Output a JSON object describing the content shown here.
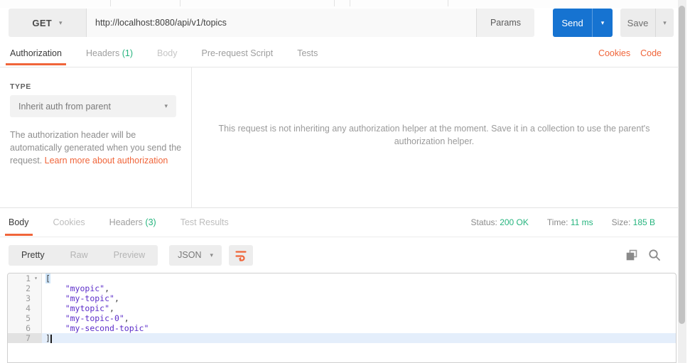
{
  "request": {
    "method": "GET",
    "url": "http://localhost:8080/api/v1/topics",
    "params_label": "Params",
    "send_label": "Send",
    "save_label": "Save"
  },
  "request_tabs": {
    "items": [
      {
        "label": "Authorization"
      },
      {
        "label": "Headers",
        "count": "(1)"
      },
      {
        "label": "Body"
      },
      {
        "label": "Pre-request Script"
      },
      {
        "label": "Tests"
      }
    ],
    "cookies_link": "Cookies",
    "code_link": "Code"
  },
  "auth": {
    "type_label": "TYPE",
    "type_value": "Inherit auth from parent",
    "description": "The authorization header will be automatically generated when you send the request. ",
    "learn_more": "Learn more about authorization",
    "helper_message": "This request is not inheriting any authorization helper at the moment. Save it in a collection to use the parent's authorization helper."
  },
  "response": {
    "tabs": [
      {
        "label": "Body"
      },
      {
        "label": "Cookies"
      },
      {
        "label": "Headers",
        "count": "(3)"
      },
      {
        "label": "Test Results"
      }
    ],
    "status_label": "Status:",
    "status_value": "200 OK",
    "time_label": "Time:",
    "time_value": "11 ms",
    "size_label": "Size:",
    "size_value": "185 B",
    "view_modes": {
      "pretty": "Pretty",
      "raw": "Raw",
      "preview": "Preview"
    },
    "format_value": "JSON",
    "body_lines": [
      {
        "num": "1",
        "fold": true,
        "tokens": [
          {
            "t": "pm",
            "v": "["
          }
        ]
      },
      {
        "num": "2",
        "tokens": [
          {
            "t": "p",
            "v": "    "
          },
          {
            "t": "s",
            "v": "\"myopic\""
          },
          {
            "t": "p",
            "v": ","
          }
        ]
      },
      {
        "num": "3",
        "tokens": [
          {
            "t": "p",
            "v": "    "
          },
          {
            "t": "s",
            "v": "\"my-topic\""
          },
          {
            "t": "p",
            "v": ","
          }
        ]
      },
      {
        "num": "4",
        "tokens": [
          {
            "t": "p",
            "v": "    "
          },
          {
            "t": "s",
            "v": "\"mytopic\""
          },
          {
            "t": "p",
            "v": ","
          }
        ]
      },
      {
        "num": "5",
        "tokens": [
          {
            "t": "p",
            "v": "    "
          },
          {
            "t": "s",
            "v": "\"my-topic-0\""
          },
          {
            "t": "p",
            "v": ","
          }
        ]
      },
      {
        "num": "6",
        "tokens": [
          {
            "t": "p",
            "v": "    "
          },
          {
            "t": "s",
            "v": "\"my-second-topic\""
          }
        ]
      },
      {
        "num": "7",
        "active": true,
        "cursor": true,
        "tokens": [
          {
            "t": "p",
            "v": "]"
          }
        ]
      }
    ],
    "body_json": [
      "myopic",
      "my-topic",
      "mytopic",
      "my-topic-0",
      "my-second-topic"
    ]
  },
  "colors": {
    "accent_orange": "#f0653a",
    "status_green": "#26b47e",
    "send_blue": "#1673d1",
    "string_purple": "#5b2cc9"
  }
}
